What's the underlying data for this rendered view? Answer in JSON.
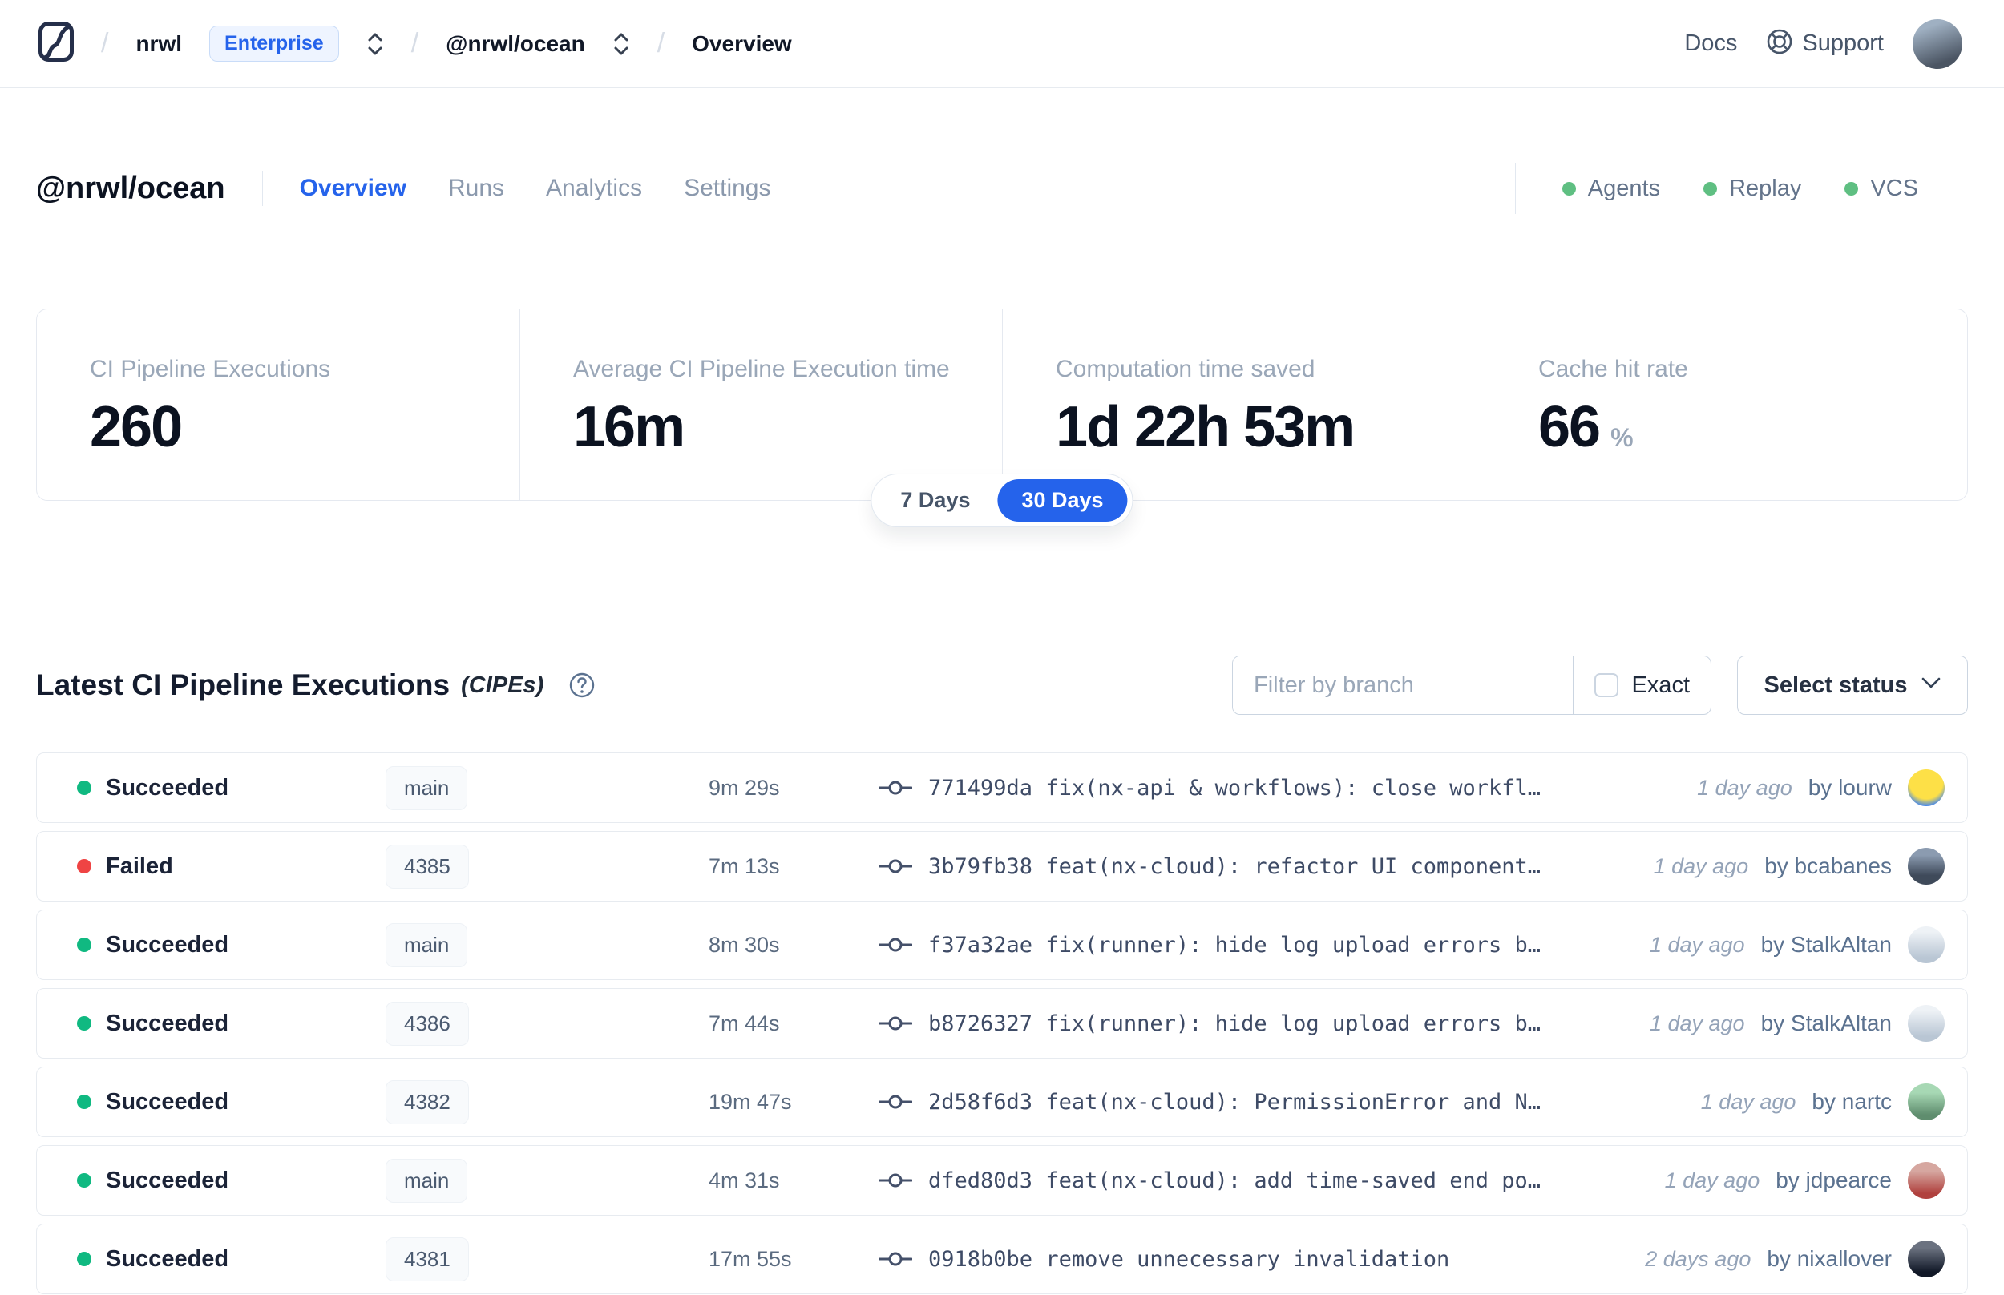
{
  "nav": {
    "separator": "/",
    "breadcrumb": {
      "org": "nrwl",
      "org_badge": "Enterprise",
      "workspace": "@nrwl/ocean",
      "page": "Overview"
    },
    "docs_label": "Docs",
    "support_label": "Support",
    "avatar_css": "linear-gradient(160deg,#9fb0c2 20%,#4b5563 80%)"
  },
  "workspace_header": {
    "title": "@nrwl/ocean",
    "tabs": [
      {
        "label": "Overview",
        "active": true
      },
      {
        "label": "Runs",
        "active": false
      },
      {
        "label": "Analytics",
        "active": false
      },
      {
        "label": "Settings",
        "active": false
      }
    ],
    "feature_dot_color": "#5fbf82",
    "features": [
      {
        "label": "Agents"
      },
      {
        "label": "Replay"
      },
      {
        "label": "VCS"
      }
    ]
  },
  "stats": {
    "cards": [
      {
        "label": "CI Pipeline Executions",
        "value": "260",
        "unit": ""
      },
      {
        "label": "Average CI Pipeline Execution time",
        "value": "16m",
        "unit": ""
      },
      {
        "label": "Computation time saved",
        "value": "1d 22h 53m",
        "unit": ""
      },
      {
        "label": "Cache hit rate",
        "value": "66",
        "unit": "%"
      }
    ],
    "accent_color": "#2563eb",
    "range_options": [
      {
        "label": "7 Days",
        "selected": false
      },
      {
        "label": "30 Days",
        "selected": true
      }
    ]
  },
  "cipes": {
    "title": "Latest CI Pipeline Executions",
    "title_suffix": "(CIPEs)",
    "filter": {
      "placeholder": "Filter by branch",
      "exact_label": "Exact",
      "exact_checked": false
    },
    "status_select_label": "Select status",
    "rows": [
      {
        "status": "Succeeded",
        "dot_color": "#10b981",
        "branch": "main",
        "duration": "9m 29s",
        "commit_hash": "771499da",
        "commit_message": "fix(nx-api & workflows): close workfl…",
        "time_ago": "1 day ago",
        "author": "by lourw",
        "avatar_css": "radial-gradient(circle at 50% 35%,#fde047 55%,#3b82f6 80%)"
      },
      {
        "status": "Failed",
        "dot_color": "#ef4444",
        "branch": "4385",
        "duration": "7m 13s",
        "commit_hash": "3b79fb38",
        "commit_message": "feat(nx-cloud): refactor UI component…",
        "time_ago": "1 day ago",
        "author": "by bcabanes",
        "avatar_css": "linear-gradient(180deg,#8b9bb0 20%,#3f4a5a 75%)"
      },
      {
        "status": "Succeeded",
        "dot_color": "#10b981",
        "branch": "main",
        "duration": "8m 30s",
        "commit_hash": "f37a32ae",
        "commit_message": "fix(runner): hide log upload errors b…",
        "time_ago": "1 day ago",
        "author": "by StalkAltan",
        "avatar_css": "linear-gradient(180deg,#eef2f6 15%,#b9c6d4 85%)"
      },
      {
        "status": "Succeeded",
        "dot_color": "#10b981",
        "branch": "4386",
        "duration": "7m 44s",
        "commit_hash": "b8726327",
        "commit_message": "fix(runner): hide log upload errors b…",
        "time_ago": "1 day ago",
        "author": "by StalkAltan",
        "avatar_css": "linear-gradient(180deg,#eef2f6 15%,#b9c6d4 85%)"
      },
      {
        "status": "Succeeded",
        "dot_color": "#10b981",
        "branch": "4382",
        "duration": "19m 47s",
        "commit_hash": "2d58f6d3",
        "commit_message": "feat(nx-cloud): PermissionError and N…",
        "time_ago": "1 day ago",
        "author": "by nartc",
        "avatar_css": "linear-gradient(180deg,#a7d8b4 25%,#5f8d6e 85%)"
      },
      {
        "status": "Succeeded",
        "dot_color": "#10b981",
        "branch": "main",
        "duration": "4m 31s",
        "commit_hash": "dfed80d3",
        "commit_message": "feat(nx-cloud): add time-saved end po…",
        "time_ago": "1 day ago",
        "author": "by jdpearce",
        "avatar_css": "linear-gradient(180deg,#d6a7a0 25%,#b0413e 85%)"
      },
      {
        "status": "Succeeded",
        "dot_color": "#10b981",
        "branch": "4381",
        "duration": "17m 55s",
        "commit_hash": "0918b0be",
        "commit_message": "remove unnecessary invalidation",
        "time_ago": "2 days ago",
        "author": "by nixallover",
        "avatar_css": "linear-gradient(180deg,#6b7280 20%,#111827 85%)"
      }
    ]
  }
}
